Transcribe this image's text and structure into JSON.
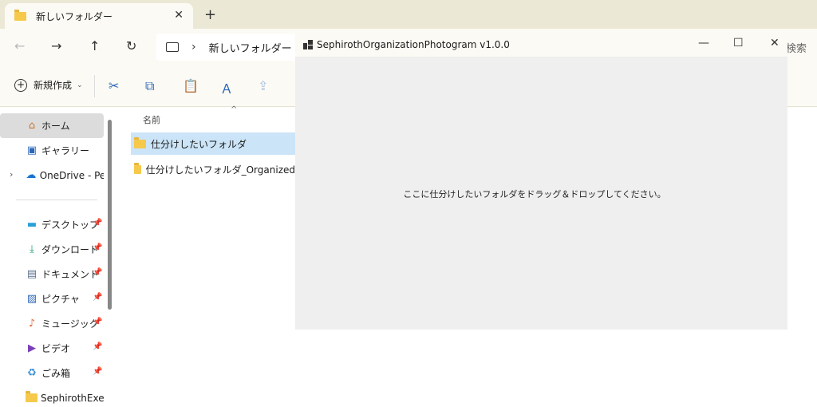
{
  "explorer": {
    "tab": {
      "title": "新しいフォルダー",
      "close": "✕"
    },
    "new_tab": "+",
    "nav": {
      "back": "←",
      "forward": "→",
      "up": "↑",
      "refresh": "↻"
    },
    "address": {
      "chevron": "›",
      "path": "新しいフォルダー"
    },
    "search_hint": "検索",
    "command_bar": {
      "new_label": "新規作成",
      "new_dropdown": "⌄",
      "cut": "✂",
      "copy": "⧉",
      "paste": "📋",
      "rename": "Ａ",
      "share": "⇪"
    },
    "sidebar": {
      "items": [
        {
          "label": "ホーム",
          "icon": "home-icon",
          "glyph": "⌂"
        },
        {
          "label": "ギャラリー",
          "icon": "gallery-icon",
          "glyph": "▣"
        },
        {
          "label": "OneDrive - Pers",
          "icon": "cloud-icon",
          "glyph": "☁"
        },
        {
          "label": "デスクトップ",
          "icon": "desktop-icon",
          "glyph": "▬"
        },
        {
          "label": "ダウンロード",
          "icon": "download-icon",
          "glyph": "⤓"
        },
        {
          "label": "ドキュメント",
          "icon": "document-icon",
          "glyph": "▤"
        },
        {
          "label": "ピクチャ",
          "icon": "picture-icon",
          "glyph": "▨"
        },
        {
          "label": "ミュージック",
          "icon": "music-icon",
          "glyph": "♪"
        },
        {
          "label": "ビデオ",
          "icon": "video-icon",
          "glyph": "▶"
        },
        {
          "label": "ごみ箱",
          "icon": "recycle-bin-icon",
          "glyph": "♻"
        },
        {
          "label": "SephirothExecN",
          "icon": "folder-icon",
          "glyph": ""
        }
      ],
      "expander": "›",
      "pin": "📌"
    },
    "file_list": {
      "column_name": "名前",
      "sort_caret": "^",
      "rows": [
        {
          "name": "仕分けしたいフォルダ"
        },
        {
          "name": "仕分けしたいフォルダ_Organized"
        }
      ]
    }
  },
  "app_window": {
    "title": "SephirothOrganizationPhotogram v1.0.0",
    "minimize": "—",
    "maximize": "☐",
    "close": "✕",
    "drop_message": "ここに仕分けしたいフォルダをドラッグ＆ドロップしてください。"
  },
  "colors": {
    "explorer_chrome": "#fbfaf4",
    "tabbar": "#ece8d6",
    "selection_blue": "#cce4f7",
    "sidebar_selected": "#dcdcdc",
    "folder_yellow": "#f6c94a",
    "app_body": "#efefef",
    "accent_icon": "#2a66b8"
  }
}
